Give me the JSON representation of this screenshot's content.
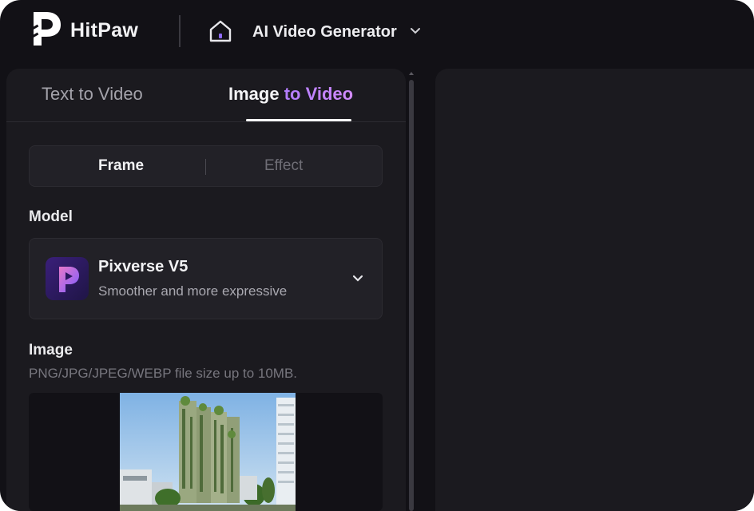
{
  "header": {
    "brand": "HitPaw",
    "product": "AI Video Generator"
  },
  "tabs": [
    {
      "label": "Text to Video",
      "active": false
    },
    {
      "label_part1": "Image",
      "label_part2": " to Video",
      "active": true
    }
  ],
  "segment": {
    "frame_label": "Frame",
    "effect_label": "Effect",
    "active": "Frame"
  },
  "model": {
    "section_label": "Model",
    "name": "Pixverse V5",
    "description": "Smoother and more expressive"
  },
  "image": {
    "section_label": "Image",
    "hint": "PNG/JPG/JPEG/WEBP file size up to 10MB."
  },
  "colors": {
    "background": "#121116",
    "panel": "#1b1a1f",
    "accent": "#b07cff"
  },
  "icons": [
    "hitpaw-logo-icon",
    "home-icon",
    "chevron-down-icon",
    "pixverse-logo-icon"
  ]
}
